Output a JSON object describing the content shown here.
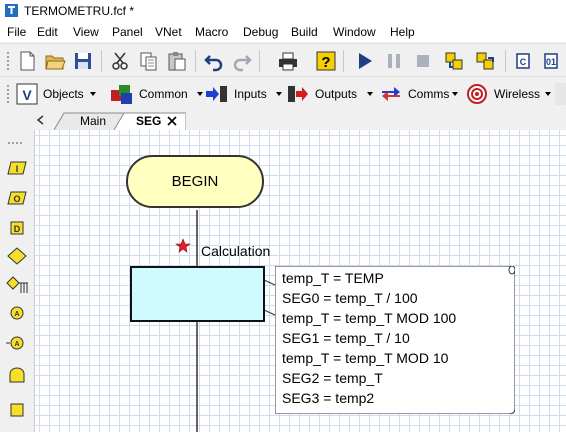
{
  "window": {
    "title": "TERMOMETRU.fcf *"
  },
  "menu": [
    "File",
    "Edit",
    "View",
    "Panel",
    "VNet",
    "Macro",
    "Debug",
    "Build",
    "Window",
    "Help"
  ],
  "toolbar": {
    "icons": [
      "new-file-icon",
      "open-folder-icon",
      "save-icon",
      "cut-icon",
      "copy-icon",
      "paste-icon",
      "undo-icon",
      "redo-icon",
      "print-icon",
      "help-icon",
      "run-icon",
      "pause-icon",
      "stop-icon",
      "step-into-icon",
      "step-over-icon",
      "chip-program-icon",
      "compile-icon"
    ]
  },
  "components": [
    {
      "label": "Objects"
    },
    {
      "label": "Common"
    },
    {
      "label": "Inputs"
    },
    {
      "label": "Outputs"
    },
    {
      "label": "Comms"
    },
    {
      "label": "Wireless"
    }
  ],
  "tabs": {
    "items": [
      {
        "label": "Main"
      },
      {
        "label": "SEG"
      }
    ],
    "active": "SEG"
  },
  "flowchart": {
    "begin_label": "BEGIN",
    "calc_label": "Calculation",
    "comment_lines": [
      "temp_T = TEMP",
      "SEG0 = temp_T / 100",
      "temp_T = temp_T MOD 100",
      "SEG1 = temp_T / 10",
      "temp_T = temp_T MOD 10",
      "SEG2 = temp_T",
      "SEG3 = temp2"
    ]
  },
  "colors": {
    "begin_fill": "#ffffc0",
    "calc_fill": "#cffaff",
    "grid": "#cfdcf0",
    "bookmark_star": "#e0202c"
  }
}
